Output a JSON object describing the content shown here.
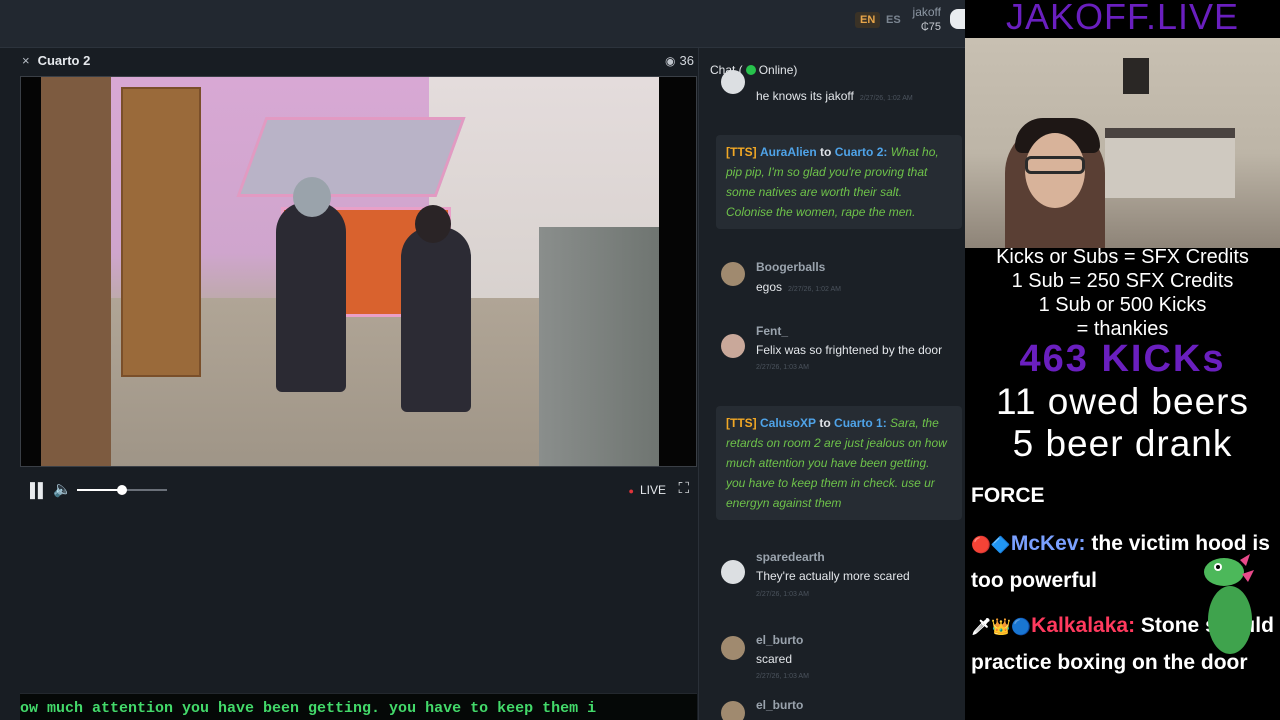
{
  "topbar": {
    "lang_en": "EN",
    "lang_es": "ES",
    "username": "jakoff",
    "coins": "₵75"
  },
  "room": {
    "close_icon": "×",
    "title": "Cuarto 2",
    "eye_icon": "◉",
    "viewers": "36",
    "controls": {
      "pause_icon": "pause-icon",
      "volume_icon": "speaker-icon",
      "volume_level": 0.5,
      "live_label": "LIVE",
      "fullscreen_icon": "fullscreen-icon"
    },
    "ticker": "ow much attention you have been getting. you have to keep them i"
  },
  "chat": {
    "header_prefix": "Chat (",
    "header_status": "Online)",
    "messages": [
      {
        "type": "plain",
        "name": "",
        "text": "he knows its jakoff",
        "time": "2/27/26, 1:02 AM"
      },
      {
        "type": "tts",
        "tag": "[TTS]",
        "from": "AuraAlien",
        "to_word": "to",
        "room": "Cuarto 2:",
        "text": "What ho, pip pip, I'm so glad you're proving that some natives are worth their salt. Colonise the women, rape the men."
      },
      {
        "type": "plain",
        "name": "Boogerballs",
        "text": "egos",
        "time": "2/27/26, 1:02 AM"
      },
      {
        "type": "plain",
        "name": "Fent_",
        "text": "Felix was so frightened by the door",
        "time": "2/27/26, 1:03 AM"
      },
      {
        "type": "tts",
        "tag": "[TTS]",
        "from": "CalusoXP",
        "to_word": "to",
        "room": "Cuarto 1:",
        "text": "Sara, the retards on room 2 are just jealous on how much attention you have been getting. you have to keep them in check. use ur energyn against them"
      },
      {
        "type": "plain",
        "name": "sparedearth",
        "text": "They're actually more scared",
        "time": "2/27/26, 1:03 AM"
      },
      {
        "type": "plain",
        "name": "el_burto",
        "text": "scared",
        "time": "2/27/26, 1:03 AM"
      },
      {
        "type": "plain",
        "name": "el_burto",
        "text": "",
        "time": ""
      }
    ]
  },
  "overlay": {
    "title": "JAKOFF.LIVE",
    "credits_lines": [
      "Kicks or Subs = SFX Credits",
      "1 Sub = 250 SFX Credits",
      "1 Sub or 500 Kicks",
      "= thankies"
    ],
    "kicks": "463 KICKs",
    "owed_beers": "11 owed beers",
    "beers_drank": "5 beer drank",
    "chat": [
      {
        "name": "",
        "text": "FORCE"
      },
      {
        "name": "McKev:",
        "text": "the victim hood is too powerful"
      },
      {
        "name": "Kalkalaka:",
        "text": "Stone should practice boxing on the door"
      }
    ]
  }
}
